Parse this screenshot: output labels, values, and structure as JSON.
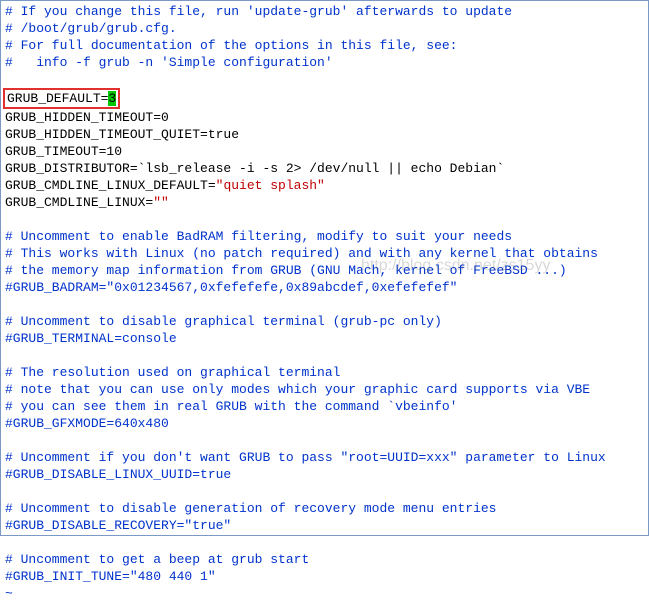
{
  "lines": [
    {
      "segs": [
        {
          "t": "# If you change this file, run 'update-grub' afterwards to update",
          "cls": "c-blue"
        }
      ]
    },
    {
      "segs": [
        {
          "t": "# /boot/grub/grub.cfg.",
          "cls": "c-blue"
        }
      ]
    },
    {
      "segs": [
        {
          "t": "# For full documentation of the options in this file, see:",
          "cls": "c-blue"
        }
      ]
    },
    {
      "segs": [
        {
          "t": "#   info -f grub -n 'Simple configuration'",
          "cls": "c-blue"
        }
      ]
    },
    {
      "segs": [
        {
          "t": " ",
          "cls": "c-black"
        }
      ]
    },
    {
      "boxed": true,
      "segs": [
        {
          "t": "GRUB_DEFAULT=",
          "cls": "c-black"
        },
        {
          "t": "3",
          "cls": "c-green-bg"
        }
      ]
    },
    {
      "segs": [
        {
          "t": "GRUB_HIDDEN_TIMEOUT=0",
          "cls": "c-black"
        }
      ]
    },
    {
      "segs": [
        {
          "t": "GRUB_HIDDEN_TIMEOUT_QUIET=true",
          "cls": "c-black"
        }
      ]
    },
    {
      "segs": [
        {
          "t": "GRUB_TIMEOUT=10",
          "cls": "c-black"
        }
      ]
    },
    {
      "segs": [
        {
          "t": "GRUB_DISTRIBUTOR=`lsb_release -i -s 2> /dev/null || echo Debian`",
          "cls": "c-black"
        }
      ]
    },
    {
      "segs": [
        {
          "t": "GRUB_CMDLINE_LINUX_DEFAULT=",
          "cls": "c-black"
        },
        {
          "t": "\"quiet splash\"",
          "cls": "c-red"
        }
      ]
    },
    {
      "segs": [
        {
          "t": "GRUB_CMDLINE_LINUX=",
          "cls": "c-black"
        },
        {
          "t": "\"\"",
          "cls": "c-red"
        }
      ]
    },
    {
      "segs": [
        {
          "t": " ",
          "cls": "c-black"
        }
      ]
    },
    {
      "segs": [
        {
          "t": "# Uncomment to enable BadRAM filtering, modify to suit your needs",
          "cls": "c-blue"
        }
      ]
    },
    {
      "segs": [
        {
          "t": "# This works with Linux (no patch required) and with any kernel that obtains",
          "cls": "c-blue"
        }
      ]
    },
    {
      "segs": [
        {
          "t": "# the memory map information from GRUB (GNU Mach, kernel of FreeBSD ...)",
          "cls": "c-blue"
        }
      ]
    },
    {
      "segs": [
        {
          "t": "#GRUB_BADRAM=\"0x01234567,0xfefefefe,0x89abcdef,0xefefefef\"",
          "cls": "c-blue"
        }
      ]
    },
    {
      "segs": [
        {
          "t": " ",
          "cls": "c-black"
        }
      ]
    },
    {
      "segs": [
        {
          "t": "# Uncomment to disable graphical terminal (grub-pc only)",
          "cls": "c-blue"
        }
      ]
    },
    {
      "segs": [
        {
          "t": "#GRUB_TERMINAL=console",
          "cls": "c-blue"
        }
      ]
    },
    {
      "segs": [
        {
          "t": " ",
          "cls": "c-black"
        }
      ]
    },
    {
      "segs": [
        {
          "t": "# The resolution used on graphical terminal",
          "cls": "c-blue"
        }
      ]
    },
    {
      "segs": [
        {
          "t": "# note that you can use only modes which your graphic card supports via VBE",
          "cls": "c-blue"
        }
      ]
    },
    {
      "segs": [
        {
          "t": "# you can see them in real GRUB with the command `vbeinfo'",
          "cls": "c-blue"
        }
      ]
    },
    {
      "segs": [
        {
          "t": "#GRUB_GFXMODE=640x480",
          "cls": "c-blue"
        }
      ]
    },
    {
      "segs": [
        {
          "t": " ",
          "cls": "c-black"
        }
      ]
    },
    {
      "segs": [
        {
          "t": "# Uncomment if you don't want GRUB to pass \"root=UUID=xxx\" parameter to Linux",
          "cls": "c-blue"
        }
      ]
    },
    {
      "segs": [
        {
          "t": "#GRUB_DISABLE_LINUX_UUID=true",
          "cls": "c-blue"
        }
      ]
    },
    {
      "segs": [
        {
          "t": " ",
          "cls": "c-black"
        }
      ]
    },
    {
      "segs": [
        {
          "t": "# Uncomment to disable generation of recovery mode menu entries",
          "cls": "c-blue"
        }
      ]
    },
    {
      "segs": [
        {
          "t": "#GRUB_DISABLE_RECOVERY=\"true\"",
          "cls": "c-blue"
        }
      ]
    },
    {
      "segs": [
        {
          "t": " ",
          "cls": "c-black"
        }
      ]
    },
    {
      "segs": [
        {
          "t": "# Uncomment to get a beep at grub start",
          "cls": "c-blue"
        }
      ]
    },
    {
      "segs": [
        {
          "t": "#GRUB_INIT_TUNE=\"480 440 1\"",
          "cls": "c-blue"
        }
      ]
    },
    {
      "segs": [
        {
          "t": "~",
          "cls": "c-blue"
        }
      ]
    }
  ],
  "watermark": "http://blog.csdn.net/zs15yy"
}
